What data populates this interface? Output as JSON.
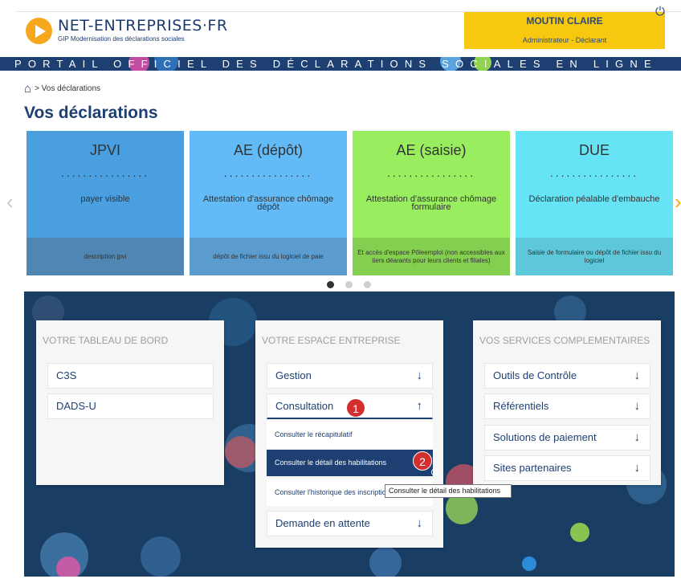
{
  "header": {
    "brand": "NET-ENTREPRISES·FR",
    "brand_sub": "GIP Modernisation des déclarations sociales",
    "user_name": "MOUTIN CLAIRE",
    "user_role": "Administrateur - Déclarant",
    "portal_text": "PORTAIL OFFICIEL DES DÉCLARATIONS SOCIALES EN LIGNE",
    "icons": {
      "logo": "play-logo-icon",
      "power": "power-icon"
    },
    "colors": {
      "brand": "#1d3f72",
      "accent": "#f8c810",
      "logo": "#f5a81c"
    }
  },
  "breadcrumb": {
    "home_icon": "home-icon",
    "current": "> Vos déclarations"
  },
  "page_title": "Vos déclarations",
  "cards": [
    {
      "title": "JPVI",
      "dots": "................",
      "desc": "payer visible",
      "footer": "description jpvi",
      "color_top": "#4a9fe0",
      "color_bottom": "#4f86b4"
    },
    {
      "title": "AE (dépôt)",
      "dots": "................",
      "desc": "Attestation d'assurance chômage dépôt",
      "footer": "dépôt de fichier issu du logiciel de paie",
      "color_top": "#62bbf6",
      "color_bottom": "#5b9ccf"
    },
    {
      "title": "AE (saisie)",
      "dots": "................",
      "desc": "Attestation d'assurance chômage formulaire",
      "footer": "Et accès d'espace Pôleemploi (non accessibles aux tiers déarants pour leurs clients et filiales)",
      "color_top": "#98ee5e",
      "color_bottom": "#84cf4f"
    },
    {
      "title": "DUE",
      "dots": "................",
      "desc": "Déclaration péalable d'embauche",
      "footer": "Saisie de formulaire ou dépôt de fichier issu du logiciel",
      "color_top": "#66e4f6",
      "color_bottom": "#5cc8d9"
    }
  ],
  "carousel": {
    "prev_icon": "chevron-left-icon",
    "next_icon": "chevron-right-icon",
    "active_slide": 1,
    "slide_count": 3
  },
  "panels": {
    "tableau": {
      "title": "VOTRE TABLEAU DE BORD",
      "items": [
        "C3S",
        "DADS-U"
      ]
    },
    "espace": {
      "title": "VOTRE ESPACE ENTREPRISE",
      "gestion": "Gestion",
      "consultation": "Consultation",
      "subitems": [
        "Consulter le récapitulatif",
        "Consulter le détail des habilitations",
        "Consulter l'historique des inscriptions"
      ],
      "attente": "Demande en attente",
      "badge1": "1",
      "badge2": "2"
    },
    "services": {
      "title": "VOS SERVICES COMPLEMENTAIRES",
      "items": [
        "Outils de Contrôle",
        "Référentiels",
        "Solutions de paiement",
        "Sites partenaires"
      ]
    }
  },
  "tooltip": "Consulter le détail des habilitations"
}
